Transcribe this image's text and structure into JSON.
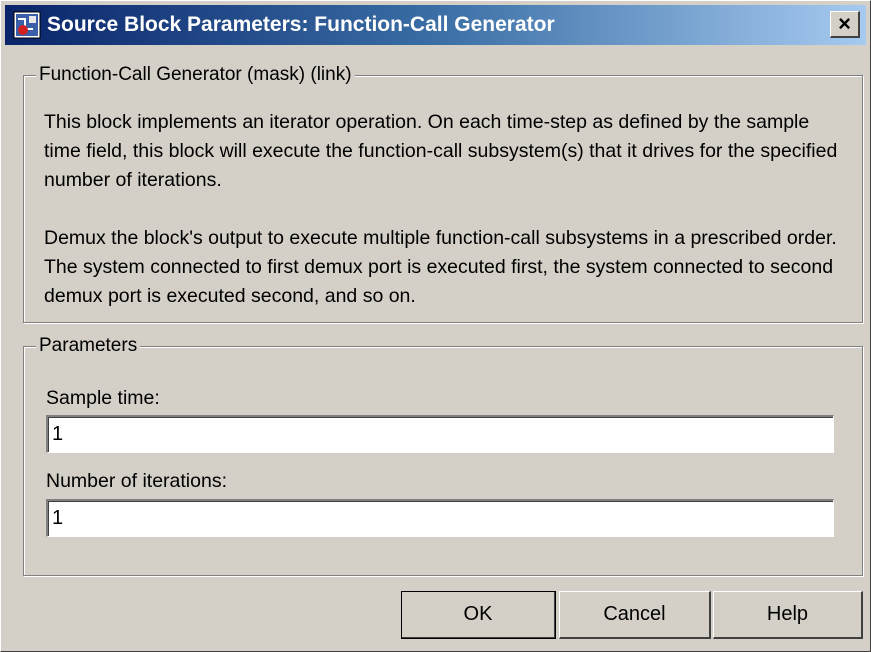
{
  "window": {
    "title": "Source Block Parameters: Function-Call Generator",
    "close_glyph": "×"
  },
  "mask_group": {
    "legend": "Function-Call Generator (mask) (link)",
    "paragraph1": "This block implements an iterator operation. On each time-step as defined by the sample time field, this block will execute the function-call subsystem(s) that it drives for the specified number of iterations.",
    "paragraph2": "Demux the block's output to execute multiple function-call subsystems in a prescribed order.  The system connected to first demux port is executed first, the system connected to second demux port is executed second, and so on."
  },
  "parameters_group": {
    "legend": "Parameters",
    "sample_time": {
      "label": "Sample time:",
      "value": "1"
    },
    "iterations": {
      "label": "Number of iterations:",
      "value": "1"
    }
  },
  "buttons": {
    "ok": "OK",
    "cancel": "Cancel",
    "help": "Help"
  },
  "icons": {
    "app": "simulink-block-icon",
    "close": "close-icon"
  },
  "colors": {
    "titlebar_start": "#0a246a",
    "titlebar_end": "#a6caf0",
    "face": "#d4d0c8"
  }
}
